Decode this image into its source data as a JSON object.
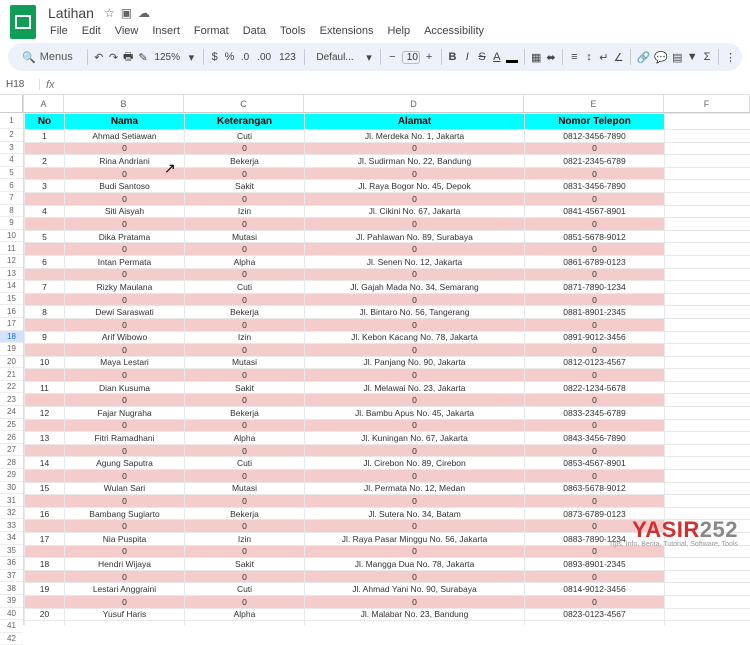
{
  "doc": {
    "title": "Latihan"
  },
  "menu": [
    "File",
    "Edit",
    "View",
    "Insert",
    "Format",
    "Data",
    "Tools",
    "Extensions",
    "Help",
    "Accessibility"
  ],
  "toolbar": {
    "search_label": "Menus",
    "zoom": "125%",
    "currency": "$",
    "percent": "%",
    "dec_dec": ".0",
    "inc_dec": ".00",
    "num_fmt": "123",
    "font": "Defaul...",
    "size": "10"
  },
  "name_box": "H18",
  "columns": [
    "A",
    "B",
    "C",
    "D",
    "E",
    "F"
  ],
  "selected_row": 18,
  "headers": [
    "No",
    "Nama",
    "Keterangan",
    "Alamat",
    "Nomor Telepon"
  ],
  "rows": [
    {
      "no": "1",
      "nama": "Ahmad Setiawan",
      "ket": "Cuti",
      "alamat": "Jl. Merdeka No. 1, Jakarta",
      "tel": "0812-3456-7890"
    },
    {
      "no": "",
      "nama": "0",
      "ket": "0",
      "alamat": "0",
      "tel": "0",
      "pink": true
    },
    {
      "no": "2",
      "nama": "Rina Andriani",
      "ket": "Bekerja",
      "alamat": "Jl. Sudirman No. 22, Bandung",
      "tel": "0821-2345-6789"
    },
    {
      "no": "",
      "nama": "0",
      "ket": "0",
      "alamat": "0",
      "tel": "0",
      "pink": true
    },
    {
      "no": "3",
      "nama": "Budi Santoso",
      "ket": "Sakit",
      "alamat": "Jl. Raya Bogor No. 45, Depok",
      "tel": "0831-3456-7890"
    },
    {
      "no": "",
      "nama": "0",
      "ket": "0",
      "alamat": "0",
      "tel": "0",
      "pink": true
    },
    {
      "no": "4",
      "nama": "Siti Aisyah",
      "ket": "Izin",
      "alamat": "Jl. Cikini No. 67, Jakarta",
      "tel": "0841-4567-8901"
    },
    {
      "no": "",
      "nama": "0",
      "ket": "0",
      "alamat": "0",
      "tel": "0",
      "pink": true
    },
    {
      "no": "5",
      "nama": "Dika Pratama",
      "ket": "Mutasi",
      "alamat": "Jl. Pahlawan No. 89, Surabaya",
      "tel": "0851-5678-9012"
    },
    {
      "no": "",
      "nama": "0",
      "ket": "0",
      "alamat": "0",
      "tel": "0",
      "pink": true
    },
    {
      "no": "6",
      "nama": "Intan Permata",
      "ket": "Alpha",
      "alamat": "Jl. Senen No. 12, Jakarta",
      "tel": "0861-6789-0123"
    },
    {
      "no": "",
      "nama": "0",
      "ket": "0",
      "alamat": "0",
      "tel": "0",
      "pink": true
    },
    {
      "no": "7",
      "nama": "Rizky Maulana",
      "ket": "Cuti",
      "alamat": "Jl. Gajah Mada No. 34, Semarang",
      "tel": "0871-7890-1234"
    },
    {
      "no": "",
      "nama": "0",
      "ket": "0",
      "alamat": "0",
      "tel": "0",
      "pink": true
    },
    {
      "no": "8",
      "nama": "Dewi Saraswati",
      "ket": "Bekerja",
      "alamat": "Jl. Bintaro No. 56, Tangerang",
      "tel": "0881-8901-2345"
    },
    {
      "no": "",
      "nama": "0",
      "ket": "0",
      "alamat": "0",
      "tel": "0",
      "pink": true
    },
    {
      "no": "9",
      "nama": "Arif Wibowo",
      "ket": "Izin",
      "alamat": "Jl. Kebon Kacang No. 78, Jakarta",
      "tel": "0891-9012-3456"
    },
    {
      "no": "",
      "nama": "0",
      "ket": "0",
      "alamat": "0",
      "tel": "0",
      "pink": true
    },
    {
      "no": "10",
      "nama": "Maya Lestari",
      "ket": "Mutasi",
      "alamat": "Jl. Panjang No. 90, Jakarta",
      "tel": "0812-0123-4567"
    },
    {
      "no": "",
      "nama": "0",
      "ket": "0",
      "alamat": "0",
      "tel": "0",
      "pink": true
    },
    {
      "no": "11",
      "nama": "Dian Kusuma",
      "ket": "Sakit",
      "alamat": "Jl. Melawai No. 23, Jakarta",
      "tel": "0822-1234-5678"
    },
    {
      "no": "",
      "nama": "0",
      "ket": "0",
      "alamat": "0",
      "tel": "0",
      "pink": true
    },
    {
      "no": "12",
      "nama": "Fajar Nugraha",
      "ket": "Bekerja",
      "alamat": "Jl. Bambu Apus No. 45, Jakarta",
      "tel": "0833-2345-6789"
    },
    {
      "no": "",
      "nama": "0",
      "ket": "0",
      "alamat": "0",
      "tel": "0",
      "pink": true
    },
    {
      "no": "13",
      "nama": "Fitri Ramadhani",
      "ket": "Alpha",
      "alamat": "Jl. Kuningan No. 67, Jakarta",
      "tel": "0843-3456-7890"
    },
    {
      "no": "",
      "nama": "0",
      "ket": "0",
      "alamat": "0",
      "tel": "0",
      "pink": true
    },
    {
      "no": "14",
      "nama": "Agung Saputra",
      "ket": "Cuti",
      "alamat": "Jl. Cirebon No. 89, Cirebon",
      "tel": "0853-4567-8901"
    },
    {
      "no": "",
      "nama": "0",
      "ket": "0",
      "alamat": "0",
      "tel": "0",
      "pink": true
    },
    {
      "no": "15",
      "nama": "Wulan Sari",
      "ket": "Mutasi",
      "alamat": "Jl. Permata No. 12, Medan",
      "tel": "0863-5678-9012"
    },
    {
      "no": "",
      "nama": "0",
      "ket": "0",
      "alamat": "0",
      "tel": "0",
      "pink": true
    },
    {
      "no": "16",
      "nama": "Bambang Sugiarto",
      "ket": "Bekerja",
      "alamat": "Jl. Sutera No. 34, Batam",
      "tel": "0873-6789-0123"
    },
    {
      "no": "",
      "nama": "0",
      "ket": "0",
      "alamat": "0",
      "tel": "0",
      "pink": true
    },
    {
      "no": "17",
      "nama": "Nia Puspita",
      "ket": "Izin",
      "alamat": "Jl. Raya Pasar Minggu No. 56, Jakarta",
      "tel": "0883-7890-1234"
    },
    {
      "no": "",
      "nama": "0",
      "ket": "0",
      "alamat": "0",
      "tel": "0",
      "pink": true
    },
    {
      "no": "18",
      "nama": "Hendri Wijaya",
      "ket": "Sakit",
      "alamat": "Jl. Mangga Dua No. 78, Jakarta",
      "tel": "0893-8901-2345"
    },
    {
      "no": "",
      "nama": "0",
      "ket": "0",
      "alamat": "0",
      "tel": "0",
      "pink": true
    },
    {
      "no": "19",
      "nama": "Lestari Anggraini",
      "ket": "Cuti",
      "alamat": "Jl. Ahmad Yani No. 90, Surabaya",
      "tel": "0814-9012-3456"
    },
    {
      "no": "",
      "nama": "0",
      "ket": "0",
      "alamat": "0",
      "tel": "0",
      "pink": true
    },
    {
      "no": "20",
      "nama": "Yusuf Haris",
      "ket": "Alpha",
      "alamat": "Jl. Malabar No. 23, Bandung",
      "tel": "0823-0123-4567"
    }
  ],
  "blank_rows_after": 2,
  "watermark": {
    "brand": "YASIR",
    "num": "252",
    "sub": "Tips, Info, Berita, Tutorial, Software, Tools"
  }
}
